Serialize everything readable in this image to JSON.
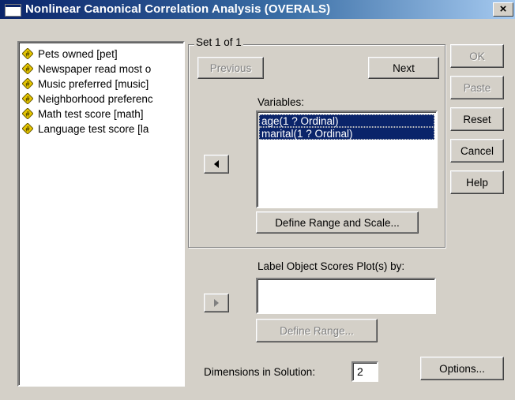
{
  "window": {
    "title": "Nonlinear Canonical Correlation Analysis (OVERALS)",
    "close_glyph": "×"
  },
  "source_variables": [
    {
      "label": "Pets owned [pet]",
      "icon": "ordinal-variable-icon"
    },
    {
      "label": "Newspaper read most o",
      "icon": "ordinal-variable-icon"
    },
    {
      "label": "Music preferred [music]",
      "icon": "ordinal-variable-icon"
    },
    {
      "label": "Neighborhood preferenc",
      "icon": "ordinal-variable-icon"
    },
    {
      "label": "Math test score [math]",
      "icon": "ordinal-variable-icon"
    },
    {
      "label": "Language test score [la",
      "icon": "ordinal-variable-icon"
    }
  ],
  "set_group": {
    "label": "Set 1 of 1",
    "previous_label": "Previous",
    "next_label": "Next",
    "variables_label": "Variables:",
    "variables": [
      "age(1 ? Ordinal)",
      "marital(1 ? Ordinal)"
    ],
    "define_range_scale_label": "Define Range and Scale..."
  },
  "label_object": {
    "label": "Label Object Scores Plot(s) by:",
    "value": "",
    "define_range_label": "Define Range..."
  },
  "dimensions": {
    "label": "Dimensions in Solution:",
    "value": "2"
  },
  "side_buttons": {
    "ok": "OK",
    "paste": "Paste",
    "reset": "Reset",
    "cancel": "Cancel",
    "help": "Help",
    "options": "Options..."
  },
  "colors": {
    "titlebar_start": "#0a246a",
    "titlebar_end": "#a6caf0",
    "selection": "#0a246a",
    "face": "#d4d0c8"
  }
}
